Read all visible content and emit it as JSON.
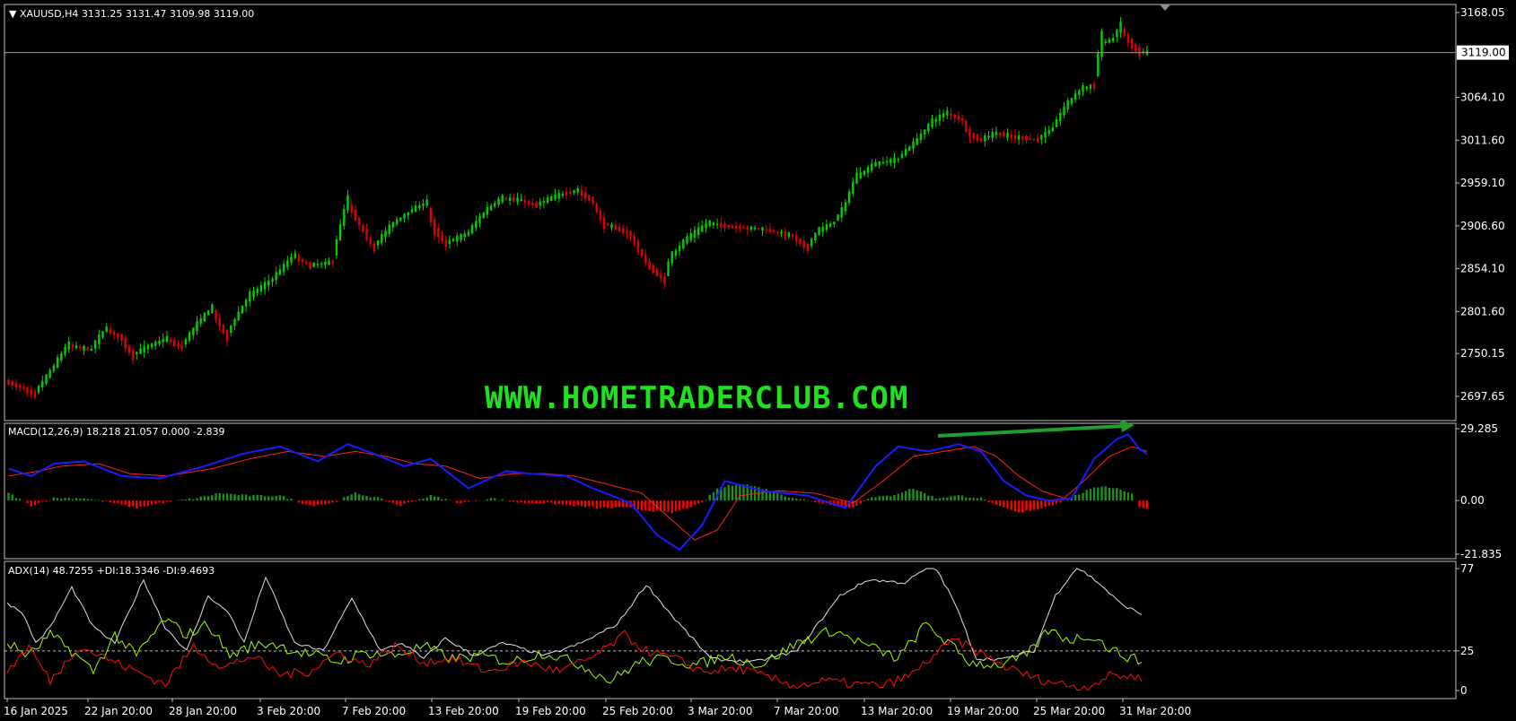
{
  "symbol_label": "XAUUSD,H4",
  "ohlc_label": "3131.25 3131.47 3109.98 3119.00",
  "watermark": "WWW.HOMETRADERCLUB.COM",
  "macd_label": "MACD(12,26,9) 18.218 21.057 0.000 -2.839",
  "adx_label": "ADX(14) 48.7255 +DI:18.3346 -DI:9.4693",
  "current_price_label": "3119.00",
  "colors": {
    "background": "#000000",
    "bull": "#00d000",
    "bear": "#e00000",
    "macd_main": "#1a1aff",
    "macd_signal": "#ff2020",
    "hist_up": "#1f8f1f",
    "hist_down": "#ff0000",
    "adx": "#e0e0e0",
    "plus_di": "#9aff00",
    "minus_di": "#ff1010",
    "arrow": "#1f9e2f",
    "watermark": "#1fe21f"
  },
  "chart_data": [
    {
      "type": "candlestick",
      "y_ticks": [
        "3168.05",
        "3064.10",
        "3011.60",
        "2959.10",
        "2906.60",
        "2854.10",
        "2801.60",
        "2750.15",
        "2697.65"
      ],
      "ylim": [
        2680,
        3168.05
      ],
      "current_price": 3119.0,
      "path": [
        [
          0,
          2715
        ],
        [
          4,
          2708
        ],
        [
          7,
          2700
        ],
        [
          11,
          2725
        ],
        [
          16,
          2760
        ],
        [
          22,
          2755
        ],
        [
          26,
          2780
        ],
        [
          30,
          2770
        ],
        [
          33,
          2748
        ],
        [
          37,
          2758
        ],
        [
          42,
          2768
        ],
        [
          46,
          2758
        ],
        [
          51,
          2790
        ],
        [
          54,
          2805
        ],
        [
          58,
          2772
        ],
        [
          64,
          2820
        ],
        [
          70,
          2840
        ],
        [
          76,
          2870
        ],
        [
          80,
          2858
        ],
        [
          86,
          2862
        ],
        [
          90,
          2935
        ],
        [
          92,
          2920
        ],
        [
          97,
          2880
        ],
        [
          102,
          2908
        ],
        [
          107,
          2925
        ],
        [
          111,
          2935
        ],
        [
          113,
          2905
        ],
        [
          116,
          2885
        ],
        [
          122,
          2897
        ],
        [
          127,
          2925
        ],
        [
          131,
          2940
        ],
        [
          136,
          2938
        ],
        [
          140,
          2932
        ],
        [
          145,
          2942
        ],
        [
          151,
          2950
        ],
        [
          155,
          2938
        ],
        [
          158,
          2910
        ],
        [
          165,
          2897
        ],
        [
          170,
          2858
        ],
        [
          174,
          2840
        ],
        [
          176,
          2868
        ],
        [
          180,
          2890
        ],
        [
          186,
          2910
        ],
        [
          192,
          2905
        ],
        [
          200,
          2903
        ],
        [
          208,
          2895
        ],
        [
          212,
          2880
        ],
        [
          215,
          2900
        ],
        [
          219,
          2910
        ],
        [
          222,
          2930
        ],
        [
          225,
          2965
        ],
        [
          230,
          2982
        ],
        [
          236,
          2988
        ],
        [
          241,
          3010
        ],
        [
          245,
          3033
        ],
        [
          249,
          3045
        ],
        [
          253,
          3037
        ],
        [
          255,
          3020
        ],
        [
          258,
          3012
        ],
        [
          262,
          3020
        ],
        [
          268,
          3015
        ],
        [
          273,
          3012
        ],
        [
          277,
          3025
        ],
        [
          281,
          3055
        ],
        [
          285,
          3075
        ],
        [
          288,
          3078
        ],
        [
          290,
          3130
        ],
        [
          293,
          3135
        ],
        [
          295,
          3150
        ],
        [
          298,
          3130
        ],
        [
          300,
          3120
        ],
        [
          302,
          3119
        ]
      ]
    },
    {
      "type": "macd",
      "label": "MACD(12,26,9)",
      "values": {
        "main": 18.218,
        "signal": 21.057,
        "histogram_up": 0.0,
        "histogram_down": -2.839
      },
      "y_ticks": [
        "29.285",
        "0.00",
        "-21.835"
      ],
      "ylim": [
        -21.835,
        29.285
      ],
      "main": [
        [
          0,
          13
        ],
        [
          6,
          10
        ],
        [
          12,
          15
        ],
        [
          20,
          16
        ],
        [
          30,
          10
        ],
        [
          40,
          9
        ],
        [
          52,
          14
        ],
        [
          62,
          19
        ],
        [
          72,
          22
        ],
        [
          82,
          16
        ],
        [
          90,
          23
        ],
        [
          97,
          19
        ],
        [
          105,
          14
        ],
        [
          112,
          17
        ],
        [
          122,
          5
        ],
        [
          132,
          12
        ],
        [
          138,
          11
        ],
        [
          148,
          10
        ],
        [
          155,
          5
        ],
        [
          165,
          -1
        ],
        [
          172,
          -14
        ],
        [
          178,
          -20
        ],
        [
          184,
          -10
        ],
        [
          190,
          8
        ],
        [
          200,
          4
        ],
        [
          212,
          2
        ],
        [
          222,
          -3
        ],
        [
          230,
          14
        ],
        [
          236,
          22
        ],
        [
          244,
          20
        ],
        [
          252,
          23
        ],
        [
          258,
          20
        ],
        [
          264,
          8
        ],
        [
          270,
          2
        ],
        [
          276,
          0
        ],
        [
          282,
          1
        ],
        [
          288,
          17
        ],
        [
          294,
          25
        ],
        [
          297,
          27
        ],
        [
          300,
          21
        ],
        [
          302,
          19
        ]
      ],
      "signal": [
        [
          0,
          10
        ],
        [
          8,
          12
        ],
        [
          14,
          14
        ],
        [
          24,
          15
        ],
        [
          32,
          11
        ],
        [
          42,
          10
        ],
        [
          54,
          13
        ],
        [
          64,
          17
        ],
        [
          74,
          20
        ],
        [
          84,
          18
        ],
        [
          92,
          20
        ],
        [
          100,
          18
        ],
        [
          108,
          15
        ],
        [
          116,
          14
        ],
        [
          125,
          9
        ],
        [
          134,
          11
        ],
        [
          142,
          11
        ],
        [
          150,
          10
        ],
        [
          158,
          7
        ],
        [
          168,
          3
        ],
        [
          176,
          -8
        ],
        [
          182,
          -16
        ],
        [
          188,
          -12
        ],
        [
          194,
          2
        ],
        [
          204,
          4
        ],
        [
          214,
          3
        ],
        [
          224,
          -1
        ],
        [
          232,
          8
        ],
        [
          240,
          18
        ],
        [
          248,
          20
        ],
        [
          256,
          22
        ],
        [
          262,
          18
        ],
        [
          268,
          10
        ],
        [
          274,
          4
        ],
        [
          280,
          1
        ],
        [
          286,
          9
        ],
        [
          292,
          18
        ],
        [
          298,
          22
        ],
        [
          302,
          20
        ]
      ],
      "histogram": [
        [
          0,
          3
        ],
        [
          6,
          -2
        ],
        [
          12,
          1
        ],
        [
          20,
          1
        ],
        [
          28,
          -1
        ],
        [
          34,
          -3
        ],
        [
          40,
          -1
        ],
        [
          50,
          1
        ],
        [
          56,
          3
        ],
        [
          64,
          2
        ],
        [
          72,
          2
        ],
        [
          80,
          -2
        ],
        [
          86,
          -1
        ],
        [
          92,
          3
        ],
        [
          98,
          1
        ],
        [
          104,
          -2
        ],
        [
          112,
          2
        ],
        [
          120,
          -1
        ],
        [
          128,
          1
        ],
        [
          136,
          -1
        ],
        [
          142,
          -1
        ],
        [
          150,
          -2
        ],
        [
          156,
          -3
        ],
        [
          164,
          -3
        ],
        [
          170,
          -4
        ],
        [
          176,
          -5
        ],
        [
          184,
          -1
        ],
        [
          188,
          5
        ],
        [
          194,
          7
        ],
        [
          200,
          5
        ],
        [
          206,
          2
        ],
        [
          212,
          0
        ],
        [
          220,
          -2
        ],
        [
          224,
          -3
        ],
        [
          228,
          1
        ],
        [
          234,
          2
        ],
        [
          240,
          5
        ],
        [
          246,
          1
        ],
        [
          252,
          2
        ],
        [
          258,
          1
        ],
        [
          262,
          -2
        ],
        [
          268,
          -5
        ],
        [
          274,
          -3
        ],
        [
          280,
          0
        ],
        [
          286,
          4
        ],
        [
          290,
          6
        ],
        [
          294,
          5
        ],
        [
          298,
          3
        ],
        [
          300,
          -3
        ],
        [
          302,
          -3
        ]
      ]
    },
    {
      "type": "adx",
      "label": "ADX(14)",
      "values": {
        "adx": 48.7255,
        "plus_di": 18.3346,
        "minus_di": 9.4693
      },
      "y_ticks": [
        "77",
        "25",
        "0"
      ],
      "ylim": [
        0,
        77
      ],
      "level": 25,
      "adx": [
        [
          0,
          55
        ],
        [
          4,
          50
        ],
        [
          8,
          30
        ],
        [
          12,
          40
        ],
        [
          18,
          65
        ],
        [
          24,
          40
        ],
        [
          30,
          30
        ],
        [
          38,
          70
        ],
        [
          44,
          40
        ],
        [
          50,
          25
        ],
        [
          56,
          60
        ],
        [
          62,
          48
        ],
        [
          66,
          30
        ],
        [
          72,
          72
        ],
        [
          80,
          30
        ],
        [
          88,
          25
        ],
        [
          96,
          58
        ],
        [
          104,
          25
        ],
        [
          110,
          30
        ],
        [
          116,
          20
        ],
        [
          122,
          33
        ],
        [
          130,
          22
        ],
        [
          138,
          30
        ],
        [
          150,
          22
        ],
        [
          160,
          30
        ],
        [
          170,
          42
        ],
        [
          178,
          67
        ],
        [
          186,
          45
        ],
        [
          196,
          20
        ],
        [
          208,
          18
        ],
        [
          220,
          25
        ],
        [
          232,
          60
        ],
        [
          240,
          70
        ],
        [
          250,
          68
        ],
        [
          258,
          80
        ],
        [
          264,
          55
        ],
        [
          270,
          20
        ],
        [
          278,
          20
        ],
        [
          286,
          25
        ],
        [
          292,
          60
        ],
        [
          298,
          78
        ],
        [
          304,
          68
        ],
        [
          310,
          55
        ],
        [
          316,
          48
        ]
      ],
      "plus_di": [
        [
          0,
          30
        ],
        [
          6,
          22
        ],
        [
          12,
          35
        ],
        [
          18,
          25
        ],
        [
          24,
          12
        ],
        [
          30,
          35
        ],
        [
          36,
          22
        ],
        [
          44,
          45
        ],
        [
          50,
          35
        ],
        [
          56,
          42
        ],
        [
          62,
          22
        ],
        [
          68,
          28
        ],
        [
          74,
          30
        ],
        [
          80,
          25
        ],
        [
          86,
          22
        ],
        [
          92,
          18
        ],
        [
          100,
          24
        ],
        [
          108,
          22
        ],
        [
          116,
          28
        ],
        [
          124,
          20
        ],
        [
          132,
          22
        ],
        [
          140,
          18
        ],
        [
          150,
          24
        ],
        [
          160,
          16
        ],
        [
          168,
          6
        ],
        [
          176,
          18
        ],
        [
          184,
          20
        ],
        [
          192,
          16
        ],
        [
          200,
          22
        ],
        [
          210,
          16
        ],
        [
          220,
          30
        ],
        [
          230,
          38
        ],
        [
          238,
          30
        ],
        [
          248,
          20
        ],
        [
          256,
          42
        ],
        [
          262,
          30
        ],
        [
          268,
          18
        ],
        [
          276,
          16
        ],
        [
          284,
          22
        ],
        [
          290,
          38
        ],
        [
          296,
          32
        ],
        [
          302,
          35
        ],
        [
          308,
          25
        ],
        [
          316,
          18
        ]
      ],
      "minus_di": [
        [
          0,
          12
        ],
        [
          6,
          28
        ],
        [
          12,
          6
        ],
        [
          20,
          28
        ],
        [
          28,
          20
        ],
        [
          36,
          12
        ],
        [
          44,
          4
        ],
        [
          52,
          28
        ],
        [
          60,
          14
        ],
        [
          68,
          22
        ],
        [
          76,
          10
        ],
        [
          84,
          12
        ],
        [
          92,
          24
        ],
        [
          100,
          16
        ],
        [
          108,
          28
        ],
        [
          116,
          18
        ],
        [
          124,
          20
        ],
        [
          134,
          12
        ],
        [
          144,
          18
        ],
        [
          154,
          12
        ],
        [
          164,
          22
        ],
        [
          172,
          35
        ],
        [
          178,
          25
        ],
        [
          186,
          20
        ],
        [
          194,
          12
        ],
        [
          204,
          14
        ],
        [
          212,
          8
        ],
        [
          220,
          3
        ],
        [
          228,
          6
        ],
        [
          236,
          4
        ],
        [
          244,
          3
        ],
        [
          252,
          10
        ],
        [
          258,
          22
        ],
        [
          264,
          32
        ],
        [
          270,
          25
        ],
        [
          278,
          15
        ],
        [
          286,
          8
        ],
        [
          294,
          4
        ],
        [
          300,
          2
        ],
        [
          308,
          10
        ],
        [
          316,
          8
        ]
      ]
    }
  ],
  "x_labels": [
    "16 Jan 2025",
    "22 Jan 20:00",
    "28 Jan 20:00",
    "3 Feb 20:00",
    "7 Feb 20:00",
    "13 Feb 20:00",
    "19 Feb 20:00",
    "25 Feb 20:00",
    "3 Mar 20:00",
    "7 Mar 20:00",
    "13 Mar 20:00",
    "19 Mar 20:00",
    "25 Mar 20:00",
    "31 Mar 20:00"
  ]
}
